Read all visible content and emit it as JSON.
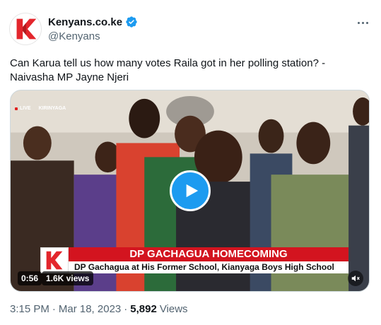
{
  "account": {
    "display_name": "Kenyans.co.ke",
    "handle": "@Kenyans",
    "verified": true,
    "brand_color": "#e3262c",
    "accent_color": "#1d9bf0"
  },
  "tweet": {
    "text": "Can Karua tell us how many votes Raila got in her polling station? - Naivasha MP Jayne Njeri"
  },
  "video": {
    "live_label": "LIVE",
    "location": "KIRINYAGA",
    "headline": "DP GACHAGUA HOMECOMING",
    "subheadline": "DP Gachagua at His Former School, Kianyaga Boys High School",
    "duration": "0:56",
    "views": "1.6K views"
  },
  "meta": {
    "time": "3:15 PM",
    "separator": "·",
    "date": "Mar 18, 2023",
    "view_count": "5,892",
    "views_label": "Views"
  },
  "icons": {
    "avatar": "kenyans-logo-icon",
    "verified": "verified-badge-icon",
    "more": "more-options-icon",
    "play": "play-icon",
    "mute": "mute-icon"
  }
}
